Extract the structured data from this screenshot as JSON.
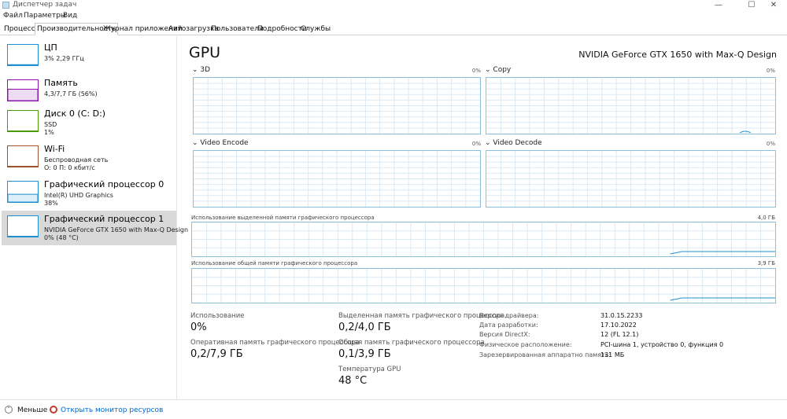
{
  "window": {
    "title": "Диспетчер задач",
    "icon": "task-manager-icon",
    "controls": {
      "minimize": "—",
      "maximize": "☐",
      "close": "✕"
    }
  },
  "menu": [
    "Файл",
    "Параметры",
    "Вид"
  ],
  "tabs": [
    "Процессы",
    "Производительность",
    "Журнал приложений",
    "Автозагрузка",
    "Пользователи",
    "Подробности",
    "Службы"
  ],
  "active_tab": "Производительность",
  "sidebar": {
    "items": [
      {
        "title": "ЦП",
        "sub1": "3% 2,29 ГГц",
        "sub2": "",
        "color": "#1f8fcf",
        "level": 0.03
      },
      {
        "title": "Память",
        "sub1": "4,3/7,7 ГБ (56%)",
        "sub2": "",
        "color": "#8b18a8",
        "level": 0.56
      },
      {
        "title": "Диск 0 (C: D:)",
        "sub1": "SSD",
        "sub2": "1%",
        "color": "#4e9a06",
        "level": 0.01
      },
      {
        "title": "Wi-Fi",
        "sub1": "Беспроводная сеть",
        "sub2": "О: 0 П: 0 кбит/с",
        "color": "#a0522d",
        "level": 0.0
      },
      {
        "title": "Графический процессор 0",
        "sub1": "Intel(R) UHD Graphics",
        "sub2": "38%",
        "color": "#1f8fcf",
        "level": 0.38
      },
      {
        "title": "Графический процессор 1",
        "sub1": "NVIDIA GeForce GTX 1650 with Max-Q Design",
        "sub2": "0% (48 °C)",
        "color": "#1f8fcf",
        "level": 0.0,
        "selected": true
      }
    ]
  },
  "main": {
    "title": "GPU",
    "gpu_name": "NVIDIA GeForce GTX 1650 with Max-Q Design",
    "engines": [
      {
        "name": "3D",
        "value": "0%"
      },
      {
        "name": "Copy",
        "value": "0%"
      },
      {
        "name": "Video Encode",
        "value": "0%"
      },
      {
        "name": "Video Decode",
        "value": "0%"
      }
    ],
    "dedicated_memory_graph": {
      "label": "Использование выделенной памяти графического процессора",
      "max": "4,0 ГБ"
    },
    "shared_memory_graph": {
      "label": "Использование общей памяти графического процессора",
      "max": "3,9 ГБ"
    },
    "stats": {
      "utilization": {
        "label": "Использование",
        "value": "0%"
      },
      "gpu_memory": {
        "label": "Оперативная память графического процессора",
        "value": "0,2/7,9 ГБ"
      },
      "dedicated_memory": {
        "label": "Выделенная память графического процессора",
        "value": "0,2/4,0 ГБ"
      },
      "shared_memory": {
        "label": "Общая память графического процессора",
        "value": "0,1/3,9 ГБ"
      },
      "temperature": {
        "label": "Температура GPU",
        "value": "48 °C"
      }
    },
    "properties": [
      {
        "label": "Версия драйвера:",
        "value": "31.0.15.2233"
      },
      {
        "label": "Дата разработки:",
        "value": "17.10.2022"
      },
      {
        "label": "Версия DirectX:",
        "value": "12 (FL 12.1)"
      },
      {
        "label": "Физическое расположение:",
        "value": "PCI-шина 1, устройство 0, функция 0"
      },
      {
        "label": "Зарезервированная аппаратно память:",
        "value": "131 МБ"
      }
    ]
  },
  "footer": {
    "less_label": "Меньше",
    "less_icon": "chevron-up-icon",
    "monitor_label": "Открыть монитор ресурсов",
    "monitor_icon": "resource-monitor-icon",
    "link_color": "#0066cc"
  },
  "colors": {
    "graph_border": "#8bbfe0",
    "grid": "#dbe9f3",
    "selected_bg": "#d9d9d9"
  }
}
